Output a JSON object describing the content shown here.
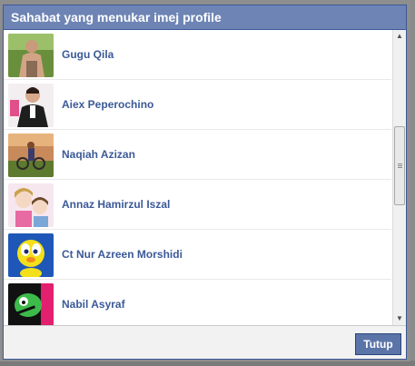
{
  "dialog": {
    "title": "Sahabat yang menukar imej profile",
    "close_label": "Tutup"
  },
  "friends": [
    {
      "name": "Gugu Qila"
    },
    {
      "name": "Aiex Peperochino"
    },
    {
      "name": "Naqiah Azizan"
    },
    {
      "name": "Annaz Hamirzul Iszal"
    },
    {
      "name": "Ct Nur Azreen Morshidi"
    },
    {
      "name": "Nabil Asyraf"
    }
  ],
  "colors": {
    "title_bar": "#6d84b4",
    "link": "#3b5998",
    "button": "#5b74a8"
  }
}
